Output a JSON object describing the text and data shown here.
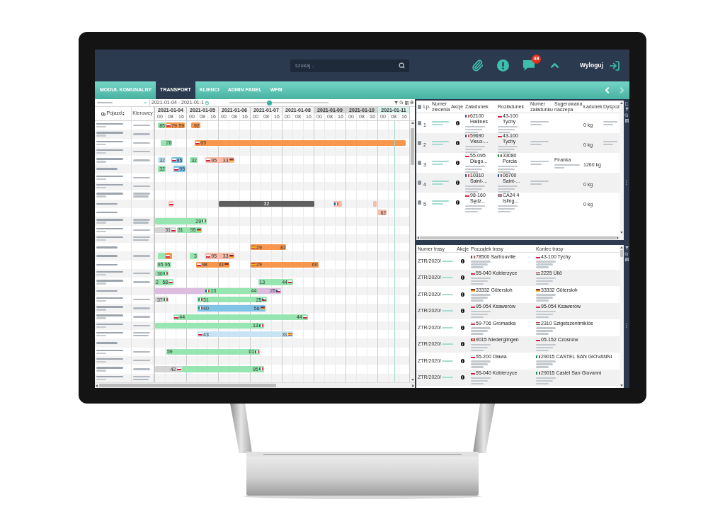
{
  "header": {
    "search": {
      "placeholder": "szukaj .."
    },
    "notifications_badge": "49",
    "logout_label": "Wyloguj"
  },
  "tabs": [
    {
      "label": "MODUŁ KOMUNALNY",
      "selected": false
    },
    {
      "label": "TRANSPORT",
      "selected": true
    },
    {
      "label": "KLIENCI",
      "selected": false
    },
    {
      "label": "ADMIN PANEL",
      "selected": false
    },
    {
      "label": "WFM",
      "selected": false
    }
  ],
  "tab_scroll": {
    "left_disabled": false,
    "right_disabled": true
  },
  "gantt": {
    "date_range": "2021-01-04 - 2021-01-1",
    "zoom_slider": {
      "level": 0.4
    },
    "columns": {
      "vehicle": "Pojazd",
      "drivers": "Kierowcy"
    },
    "days": [
      {
        "date": "2021-01-04",
        "kind": "workday",
        "hours": [
          "00",
          "08",
          "16"
        ]
      },
      {
        "date": "2021-01-05",
        "kind": "workday",
        "hours": [
          "00",
          "08",
          "16"
        ]
      },
      {
        "date": "2021-01-06",
        "kind": "workday",
        "hours": [
          "00",
          "08",
          "16"
        ]
      },
      {
        "date": "2021-01-07",
        "kind": "workday",
        "hours": [
          "00",
          "08",
          "16"
        ]
      },
      {
        "date": "2021-01-08",
        "kind": "workday",
        "hours": [
          "00",
          "08",
          "16"
        ]
      },
      {
        "date": "2021-01-09",
        "kind": "weekend",
        "hours": [
          "00",
          "08",
          "16"
        ]
      },
      {
        "date": "2021-01-10",
        "kind": "weekend",
        "hours": [
          "00",
          "08",
          "16"
        ]
      },
      {
        "date": "2021-01-11",
        "kind": "today",
        "hours": [
          "00",
          "08",
          "16"
        ]
      }
    ],
    "rows": [
      {
        "vehicle": {
          "kind": "two-line"
        },
        "driver": {
          "kind": "one-line"
        },
        "bars": [
          {
            "kind": "task",
            "color": "#97e5b0",
            "end": {
              "kind": "plain",
              "label": "85"
            }
          },
          {
            "kind": "task",
            "color": "#f7964d",
            "start": {
              "kind": "flag-pl",
              "label": "79"
            },
            "end": {
              "kind": "plain",
              "label": "59"
            }
          },
          {
            "kind": "task",
            "color": "#f7964d",
            "end": {
              "kind": "plain",
              "label": "92"
            }
          }
        ]
      },
      {
        "vehicle": {
          "kind": "two-line"
        },
        "driver": {
          "kind": "one-line"
        },
        "bars": []
      },
      {
        "vehicle": {
          "kind": "two-line"
        },
        "driver": {
          "kind": "one-line"
        },
        "bars": [
          {
            "kind": "task",
            "color": "#97e5b0",
            "end": {
              "kind": "plain",
              "label": "26"
            }
          },
          {
            "kind": "task",
            "color": "#f7964d",
            "start": {
              "kind": "flag-pl",
              "label": "65"
            }
          }
        ]
      },
      {
        "vehicle": {
          "kind": "two-line"
        },
        "driver": {
          "kind": "one-line"
        },
        "bars": []
      },
      {
        "vehicle": {
          "kind": "two-line"
        },
        "driver": {
          "kind": "one-line"
        },
        "bars": [
          {
            "kind": "task",
            "color": "#c6e4f4",
            "end": {
              "kind": "plain",
              "label": "32"
            }
          },
          {
            "kind": "task",
            "color": "#7fc4e6",
            "start": {
              "kind": "flag-pl",
              "label": "95"
            }
          },
          {
            "kind": "task",
            "color": "#97e5b0",
            "end": {
              "kind": "plain",
              "label": "32"
            }
          },
          {
            "kind": "task",
            "color": "#f9bcaa",
            "start": {
              "kind": "flag-pl",
              "label": "95"
            },
            "end": {
              "kind": "flag-de",
              "label": "33"
            }
          }
        ]
      },
      {
        "vehicle": {
          "kind": "one-line"
        },
        "driver": {
          "kind": "none"
        },
        "bars": [
          {
            "kind": "task",
            "color": "#97e5b0",
            "end": {
              "kind": "plain",
              "label": "32"
            }
          },
          {
            "kind": "task",
            "color": "#7fc4e6",
            "start": {
              "kind": "flag-pl",
              "label": "95"
            }
          }
        ]
      },
      {
        "vehicle": {
          "kind": "two-line"
        },
        "driver": {
          "kind": "one-line"
        },
        "bars": []
      },
      {
        "vehicle": {
          "kind": "two-line"
        },
        "driver": {
          "kind": "one-line"
        },
        "bars": []
      },
      {
        "vehicle": {
          "kind": "two-line"
        },
        "driver": {
          "kind": "two-line"
        },
        "bars": []
      },
      {
        "vehicle": {
          "kind": "one-line"
        },
        "driver": {
          "kind": "none"
        },
        "bars": [
          {
            "kind": "task",
            "color": "#f9bcaa",
            "start": {
              "kind": "flag-pl"
            }
          },
          {
            "kind": "task",
            "color": "#5f5f5f",
            "center_label": "32"
          },
          {
            "kind": "task",
            "color": "#f9bcaa",
            "start": {
              "kind": "flag-fr"
            }
          },
          {
            "kind": "task",
            "color": "#f9bcaa"
          }
        ]
      },
      {
        "vehicle": {
          "kind": "one-line"
        },
        "driver": {
          "kind": "none"
        },
        "bars": [
          {
            "kind": "task",
            "color": "#f9bcaa",
            "end": {
              "kind": "plain",
              "label": "62"
            }
          }
        ]
      },
      {
        "vehicle": {
          "kind": "two-line"
        },
        "driver": {
          "kind": "two-line"
        },
        "bars": [
          {
            "kind": "task",
            "color": "#97e5b0",
            "end": {
              "kind": "flag-it",
              "label": "29"
            }
          }
        ]
      },
      {
        "vehicle": {
          "kind": "two-line"
        },
        "driver": {
          "kind": "one-line"
        },
        "bars": [
          {
            "kind": "task",
            "color": "#d4d4d4",
            "end": {
              "kind": "flag-pl",
              "label": "31"
            }
          },
          {
            "kind": "task",
            "color": "#97e5b0",
            "start": {
              "kind": "plain",
              "label": "31"
            },
            "end": {
              "kind": "flag-de",
              "label": "95"
            }
          }
        ]
      },
      {
        "vehicle": {
          "kind": "two-line"
        },
        "driver": {
          "kind": "two-line"
        },
        "bars": []
      },
      {
        "vehicle": {
          "kind": "one-line"
        },
        "driver": {
          "kind": "none"
        },
        "bars": [
          {
            "kind": "task",
            "color": "#f7964d",
            "start": {
              "kind": "flag-es",
              "label": "29"
            },
            "end": {
              "kind": "plain",
              "label": "30"
            }
          }
        ]
      },
      {
        "vehicle": {
          "kind": "one-line"
        },
        "driver": {
          "kind": "one-line"
        },
        "bars": [
          {
            "kind": "task",
            "color": "#97e5b0"
          },
          {
            "kind": "task",
            "color": "#f7964d",
            "start": {
              "kind": "flag-pl"
            }
          },
          {
            "kind": "task",
            "color": "#97e5b0",
            "end": {
              "kind": "plain",
              "label": "3"
            }
          },
          {
            "kind": "task",
            "color": "#f9bcaa",
            "start": {
              "kind": "flag-pl",
              "label": "95"
            },
            "end": {
              "kind": "flag-de",
              "label": "33"
            }
          }
        ]
      },
      {
        "vehicle": {
          "kind": "one-line"
        },
        "driver": {
          "kind": "none"
        },
        "bars": [
          {
            "kind": "task",
            "color": "#97e5b0",
            "start": {
              "kind": "plain",
              "label": "95"
            },
            "end": {
              "kind": "plain",
              "label": "95"
            }
          },
          {
            "kind": "task",
            "color": "#f7964d",
            "start": {
              "kind": "flag-pl",
              "label": "98"
            },
            "end": {
              "kind": "flag-de",
              "label": "33"
            }
          },
          {
            "kind": "task",
            "color": "#f7964d",
            "start": {
              "kind": "flag-es",
              "label": "29"
            },
            "end": {
              "kind": "plain",
              "label": "60"
            }
          }
        ]
      },
      {
        "vehicle": {
          "kind": "two-line"
        },
        "driver": {
          "kind": "one-line"
        },
        "bars": [
          {
            "kind": "task",
            "color": "#97e5b0",
            "end": {
              "kind": "flag-it",
              "label": "30"
            }
          }
        ]
      },
      {
        "vehicle": {
          "kind": "two-line"
        },
        "driver": {
          "kind": "one-line"
        },
        "bars": [
          {
            "kind": "task",
            "color": "#97e5b0",
            "start": {
              "kind": "plain",
              "label": "2"
            },
            "end": {
              "kind": "flag-pl",
              "label": "58"
            }
          },
          {
            "kind": "task",
            "color": "#97e5b0",
            "start": {
              "kind": "plain",
              "label": "13"
            },
            "end": {
              "kind": "flag-pl",
              "label": "44"
            }
          }
        ]
      },
      {
        "vehicle": {
          "kind": "one-line"
        },
        "driver": {
          "kind": "none"
        },
        "bars": [
          {
            "kind": "task",
            "color": "#97e5b0",
            "start": {
              "kind": "flag-fr",
              "label": "13"
            },
            "end": {
              "kind": "plain",
              "label": "44"
            }
          },
          {
            "kind": "underlay",
            "color": "#dcbde0",
            "end": {
              "kind": "flag-cz",
              "label": "25"
            }
          }
        ]
      },
      {
        "vehicle": {
          "kind": "two-line"
        },
        "driver": {
          "kind": "one-line"
        },
        "bars": [
          {
            "kind": "task",
            "color": "#d4d4d4",
            "end": {
              "kind": "flag-it",
              "label": "37"
            }
          },
          {
            "kind": "task",
            "color": "#97e5b0",
            "start": {
              "kind": "flag-it",
              "label": "31"
            },
            "end": {
              "kind": "flag-cz",
              "label": "25"
            }
          }
        ]
      },
      {
        "vehicle": {
          "kind": "two-line"
        },
        "driver": {
          "kind": "one-line"
        },
        "bars": [
          {
            "kind": "task",
            "color": "#7fc4e6",
            "start": {
              "kind": "flag-it",
              "label": "40"
            },
            "end": {
              "kind": "flag-de",
              "label": "56"
            }
          }
        ]
      },
      {
        "vehicle": {
          "kind": "two-line"
        },
        "driver": {
          "kind": "one-line"
        },
        "bars": [
          {
            "kind": "task",
            "color": "#97e5b0",
            "start": {
              "kind": "flag-pl",
              "label": "44"
            },
            "end": {
              "kind": "flag-pl",
              "label": "44"
            }
          }
        ]
      },
      {
        "vehicle": {
          "kind": "two-line"
        },
        "driver": {
          "kind": "one-line"
        },
        "bars": [
          {
            "kind": "task",
            "color": "#97e5b0",
            "end": {
              "kind": "flag-fr",
              "label": "13"
            }
          }
        ]
      },
      {
        "vehicle": {
          "kind": "two-line"
        },
        "driver": {
          "kind": "two-line"
        },
        "bars": [
          {
            "kind": "task",
            "color": "#c6e4f4",
            "start": {
              "kind": "flag-pl",
              "label": "43"
            },
            "end": {
              "kind": "flag-es",
              "label": "31"
            }
          }
        ]
      },
      {
        "vehicle": {
          "kind": "one-line"
        },
        "driver": {
          "kind": "none"
        },
        "bars": []
      },
      {
        "vehicle": {
          "kind": "two-line"
        },
        "driver": {
          "kind": "one-line"
        },
        "bars": [
          {
            "kind": "task",
            "color": "#97e5b0",
            "start": {
              "kind": "plain",
              "label": "59"
            },
            "end": {
              "kind": "flag-fr",
              "label": "61"
            }
          }
        ]
      },
      {
        "vehicle": {
          "kind": "two-line"
        },
        "driver": {
          "kind": "one-line"
        },
        "bars": []
      },
      {
        "vehicle": {
          "kind": "two-line"
        },
        "driver": {
          "kind": "one-line"
        },
        "bars": [
          {
            "kind": "task",
            "color": "#d4d4d4",
            "end": {
              "kind": "flag-pl",
              "label": "42"
            }
          },
          {
            "kind": "task",
            "color": "#97e5b0",
            "end": {
              "kind": "flag-fr",
              "label": "95"
            }
          }
        ]
      },
      {
        "vehicle": {
          "kind": "two-line"
        },
        "driver": {
          "kind": "two-line"
        },
        "bars": []
      }
    ]
  },
  "orders_table": {
    "header_checked": false,
    "columns": [
      "Lp.",
      "Numer zlecenia",
      "Akcje",
      "Załadunek",
      "Rozładunek",
      "Numer załadunku",
      "Sugerowana naczepa",
      "Ładunek",
      "Dyspoz"
    ],
    "rows": [
      {
        "checked": false,
        "lp": "1",
        "loading": {
          "kind": "flag-fr",
          "place": "62100 Hallines"
        },
        "unloading": {
          "kind": "flag-pl",
          "place": "43-100 Tychy"
        },
        "load_number_blurred": true,
        "cargo": "0 kg",
        "dispatcher_blurred": true
      },
      {
        "checked": false,
        "lp": "2",
        "loading": {
          "kind": "flag-fr",
          "place": "59690 Vieux-..."
        },
        "unloading": {
          "kind": "flag-pl",
          "place": "43-100 Tychy"
        },
        "load_number_blurred": true,
        "cargo": "0 kg",
        "dispatcher_blurred": true
      },
      {
        "checked": false,
        "lp": "3",
        "loading": {
          "kind": "flag-pl",
          "place": "55-095 Długo..."
        },
        "unloading": {
          "kind": "flag-it",
          "place": "33080 Porcia"
        },
        "load_number_blurred": true,
        "trailer": {
          "label": "Firanka"
        },
        "cargo": "1260 kg"
      },
      {
        "checked": false,
        "lp": "4",
        "loading": {
          "kind": "flag-fr",
          "place": "10310 Saint-..."
        },
        "unloading": {
          "kind": "flag-fr",
          "place": "06700 Saint-..."
        },
        "load_number_blurred": true,
        "cargo": "0 kg"
      },
      {
        "checked": false,
        "lp": "5",
        "loading": {
          "kind": "flag-pl",
          "place": "98-160 Sędz..."
        },
        "unloading": {
          "kind": "flag-gb",
          "place": "CA24 4 Isling..."
        },
        "cargo": "0 kg"
      }
    ]
  },
  "routes_table": {
    "columns": [
      "Numer trasy",
      "Akcje",
      "Początek trasy",
      "Koniec trasy"
    ],
    "rows": [
      {
        "number": "ZTR/2020/",
        "start": {
          "kind": "flag-fr",
          "place": "78500 Sartrouville"
        },
        "end": {
          "kind": "flag-pl",
          "place": "43-100 Tychy"
        }
      },
      {
        "number": "ZTR/2020/",
        "start": {
          "kind": "flag-pl",
          "place": "55-040 Kobierzyce"
        },
        "end": {
          "kind": "flag-hu",
          "place": "2225 Üllő"
        }
      },
      {
        "number": "ZTR/2020/",
        "start": {
          "kind": "flag-de",
          "place": "33332 Gütersloh"
        },
        "end": {
          "kind": "flag-de",
          "place": "33332 Gütersloh"
        }
      },
      {
        "number": "ZTR/2020/",
        "start": {
          "kind": "flag-pl",
          "place": "95-054 Ksawerów"
        },
        "end": {
          "kind": "flag-pl",
          "place": "95-054 Ksawerów"
        }
      },
      {
        "number": "ZTR/2020/",
        "start": {
          "kind": "flag-pl",
          "place": "59-706 Gromadka"
        },
        "end": {
          "kind": "flag-hu",
          "place": "2310 Szigetszentmiklós"
        }
      },
      {
        "number": "ZTR/2020/",
        "start": {
          "kind": "flag-ch",
          "place": "9015 Niederglingen"
        },
        "end": {
          "kind": "flag-pl",
          "place": "05-152 Czosnów"
        }
      },
      {
        "number": "ZTR/2020/",
        "start": {
          "kind": "flag-pl",
          "place": "55-200 Oława"
        },
        "end": {
          "kind": "flag-it",
          "place": "29015 CASTEL SAN GIOVANNI"
        }
      },
      {
        "number": "ZTR/2020/",
        "start": {
          "kind": "flag-pl",
          "place": "55-040 Kobierzyce"
        },
        "end": {
          "kind": "flag-it",
          "place": "29015 Castel San Giovanni"
        }
      }
    ]
  }
}
